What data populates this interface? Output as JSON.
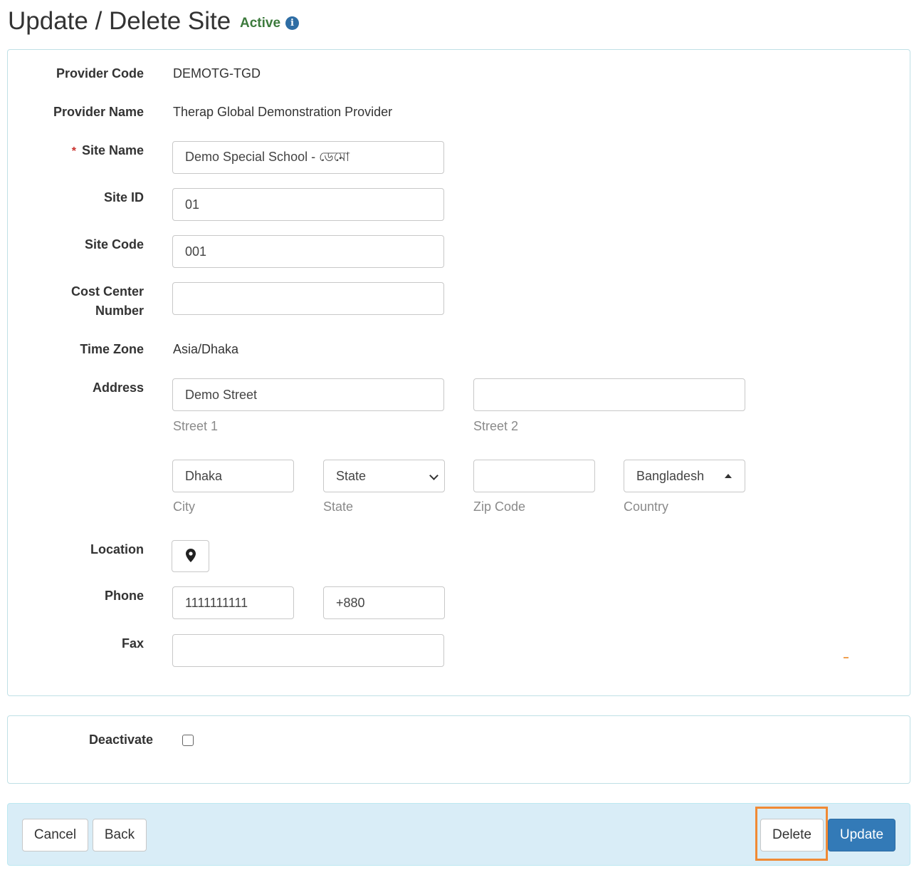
{
  "header": {
    "title": "Update / Delete Site",
    "status": "Active",
    "info_icon": "info-icon"
  },
  "form": {
    "provider_code": {
      "label": "Provider Code",
      "value": "DEMOTG-TGD"
    },
    "provider_name": {
      "label": "Provider Name",
      "value": "Therap Global Demonstration Provider"
    },
    "site_name": {
      "label": "Site Name",
      "required_mark": "*",
      "value": "Demo Special School - ডেমো"
    },
    "site_id": {
      "label": "Site ID",
      "value": "01"
    },
    "site_code": {
      "label": "Site Code",
      "value": "001"
    },
    "cost_center": {
      "label_line1": "Cost Center",
      "label_line2": "Number",
      "value": ""
    },
    "time_zone": {
      "label": "Time Zone",
      "value": "Asia/Dhaka"
    },
    "address": {
      "label": "Address",
      "street1": {
        "value": "Demo Street",
        "caption": "Street 1"
      },
      "street2": {
        "value": "",
        "caption": "Street 2"
      },
      "city": {
        "value": "Dhaka",
        "caption": "City"
      },
      "state": {
        "value": "State",
        "caption": "State"
      },
      "zip": {
        "value": "",
        "caption": "Zip Code"
      },
      "country": {
        "value": "Bangladesh",
        "caption": "Country"
      }
    },
    "location": {
      "label": "Location",
      "icon": "map-marker-icon"
    },
    "phone": {
      "label": "Phone",
      "number": "1111111111",
      "country_code": "+880"
    },
    "fax": {
      "label": "Fax",
      "value": ""
    }
  },
  "deactivate": {
    "label": "Deactivate",
    "checked": false
  },
  "footer": {
    "cancel_label": "Cancel",
    "back_label": "Back",
    "delete_label": "Delete",
    "update_label": "Update"
  },
  "colors": {
    "status_active": "#3c7a3c",
    "primary": "#337ab7",
    "footer_bg": "#d9edf7",
    "highlight": "#f08a35",
    "required": "#c9302c"
  }
}
